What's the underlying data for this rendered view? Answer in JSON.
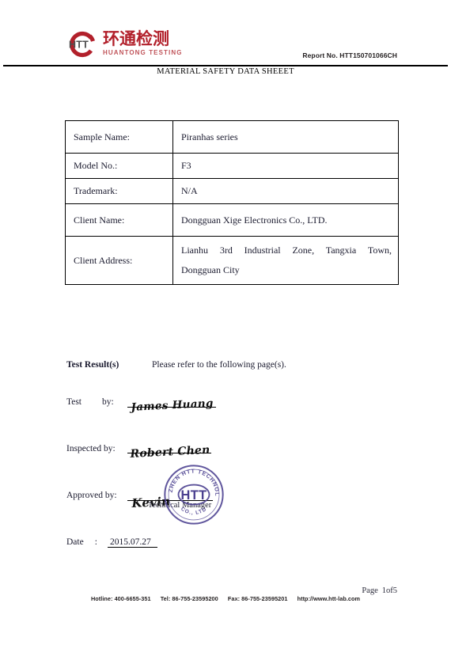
{
  "header": {
    "logo": {
      "mark_text": "HTT",
      "mark_color": "#b2202b",
      "mark_text_color": "#4d4d4d",
      "chinese_name": "环通检测",
      "english_name": "HUANTONG TESTING"
    },
    "report_no": "Report No. HTT150701066CH",
    "document_title": "MATERIAL SAFETY DATA SHEEET"
  },
  "info_table": {
    "rows": [
      {
        "key": "Sample Name:",
        "value": "Piranhas series"
      },
      {
        "key": "Model No.:",
        "value": "F3"
      },
      {
        "key": "Trademark:",
        "value": "N/A"
      },
      {
        "key": "Client Name:",
        "value": "Dongguan Xige Electronics Co., LTD."
      },
      {
        "key": "Client Address:",
        "value_line1": "Lianhu 3rd Industrial Zone, Tangxia Town,",
        "value_line2": "Dongguan City"
      }
    ]
  },
  "results": {
    "label": "Test Result(s)",
    "text": "Please refer to the following page(s).",
    "test_by_label_1": "Test",
    "test_by_label_2": "by:",
    "test_by_signature": "James Huang",
    "inspected_by_label": "Inspected by:",
    "inspected_by_signature": "Robert Chen",
    "approved_by_label": "Approved by:",
    "approved_by_signature": "Kevin",
    "approved_by_title": "Technical Manager",
    "date_label": "Date",
    "date_colon": ":",
    "date_value": "2015.07.27"
  },
  "stamp": {
    "center_text": "HTT",
    "arc_text_top": "SHENZHEN HTT TECHNOLOGY CO., LTD",
    "color": "#4a3f8f"
  },
  "footer": {
    "page_label": "Page",
    "page_value": "1of5",
    "hotline": "Hotline: 400-6655-351",
    "tel": "Tel: 86-755-23595200",
    "fax": "Fax: 86-755-23595201",
    "website": "http://www.htt-lab.com"
  }
}
